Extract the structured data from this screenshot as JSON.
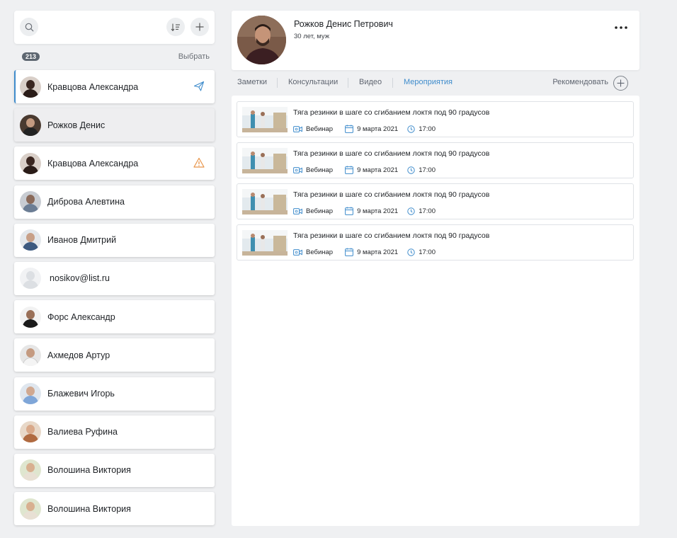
{
  "search": {
    "count_badge": "213",
    "select_label": "Выбрать"
  },
  "contacts": [
    {
      "name": "Кравцова Александра",
      "status_icon": "send-icon"
    },
    {
      "name": "Рожков Денис",
      "status_icon": ""
    },
    {
      "name": "Кравцова Александра",
      "status_icon": "warning-icon"
    },
    {
      "name": "Диброва Алевтина",
      "status_icon": ""
    },
    {
      "name": "Иванов Дмитрий",
      "status_icon": ""
    },
    {
      "name": "nosikov@list.ru",
      "status_icon": ""
    },
    {
      "name": "Форс Александр",
      "status_icon": ""
    },
    {
      "name": "Ахмедов Артур",
      "status_icon": ""
    },
    {
      "name": "Блажевич Игорь",
      "status_icon": ""
    },
    {
      "name": "Валиева Руфина",
      "status_icon": ""
    },
    {
      "name": "Волошина Виктория",
      "status_icon": ""
    },
    {
      "name": "Волошина Виктория",
      "status_icon": ""
    }
  ],
  "profile": {
    "name": "Рожков Денис Петрович",
    "meta": "30 лет, муж"
  },
  "tabs": [
    {
      "label": "Заметки"
    },
    {
      "label": "Консультации"
    },
    {
      "label": "Видео"
    },
    {
      "label": "Мероприятия"
    }
  ],
  "recommend_label": "Рекомендовать",
  "events": [
    {
      "title": "Тяга резинки в шаге со сгибанием локтя под 90 градусов",
      "type": "Вебинар",
      "date": "9 марта 2021",
      "time": "17:00"
    },
    {
      "title": "Тяга резинки в шаге со сгибанием локтя под 90 градусов",
      "type": "Вебинар",
      "date": "9 марта 2021",
      "time": "17:00"
    },
    {
      "title": "Тяга резинки в шаге со сгибанием локтя под 90 градусов",
      "type": "Вебинар",
      "date": "9 марта 2021",
      "time": "17:00"
    },
    {
      "title": "Тяга резинки в шаге со сгибанием локтя под 90 градусов",
      "type": "Вебинар",
      "date": "9 марта 2021",
      "time": "17:00"
    }
  ],
  "colors": {
    "accent": "#3f8ccc",
    "warning": "#e8954a",
    "background": "#eff0f2"
  }
}
